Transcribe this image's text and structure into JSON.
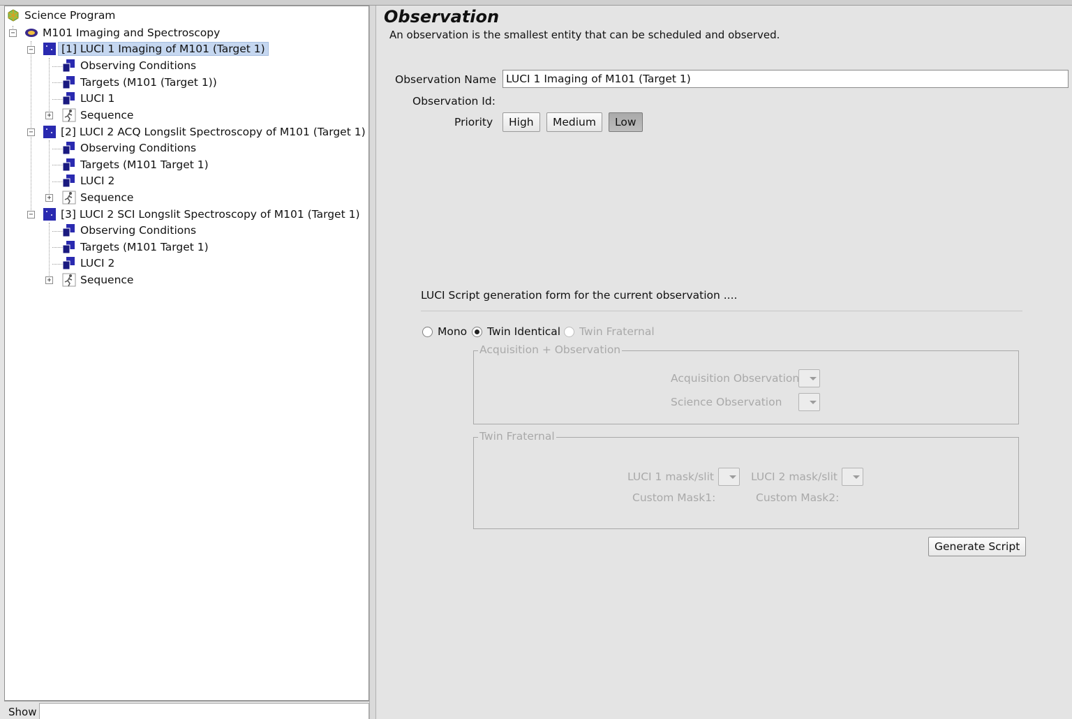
{
  "tree": {
    "root": "Science Program",
    "program": "M101 Imaging and Spectroscopy",
    "observations": [
      {
        "label": "[1] LUCI 1 Imaging of M101 (Target 1)",
        "children": [
          "Observing Conditions",
          "Targets (M101 (Target 1))",
          "LUCI 1",
          "Sequence"
        ]
      },
      {
        "label": "[2] LUCI 2 ACQ Longslit Spectroscopy of M101 (Target 1)",
        "children": [
          "Observing Conditions",
          "Targets (M101 Target 1)",
          "LUCI 2",
          "Sequence"
        ]
      },
      {
        "label": "[3] LUCI 2 SCI Longslit Spectroscopy of M101 (Target 1)",
        "children": [
          "Observing Conditions",
          "Targets (M101 Target 1)",
          "LUCI 2",
          "Sequence"
        ]
      }
    ],
    "expand_minus": "−",
    "expand_plus": "+"
  },
  "show_bar": {
    "label": "Show",
    "value": ""
  },
  "editor": {
    "title": "Observation",
    "subtitle": "An observation is the smallest entity that can be scheduled and observed.",
    "name_label": "Observation Name",
    "name_value": "LUCI 1 Imaging of M101 (Target 1)",
    "id_label": "Observation Id:",
    "priority_label": "Priority",
    "priorities": [
      "High",
      "Medium",
      "Low"
    ],
    "selected_priority": "Low"
  },
  "script_form": {
    "heading": "LUCI Script generation form for the current observation ....",
    "modes": [
      "Mono",
      "Twin Identical",
      "Twin Fraternal"
    ],
    "selected_mode": "Twin Identical",
    "acq_group": {
      "title": "Acquisition + Observation",
      "acq_label": "Acquisition Observation",
      "sci_label": "Science Observation"
    },
    "fraternal_group": {
      "title": "Twin Fraternal",
      "luci1_label": "LUCI 1 mask/slit",
      "luci2_label": "LUCI 2 mask/slit",
      "mask1_label": "Custom Mask1:",
      "mask2_label": "Custom Mask2:"
    },
    "generate_label": "Generate Script"
  },
  "colors": {
    "selection": "#c5d7f0",
    "panel_bg": "#e4e4e4",
    "disabled_text": "#a9a9a9"
  }
}
